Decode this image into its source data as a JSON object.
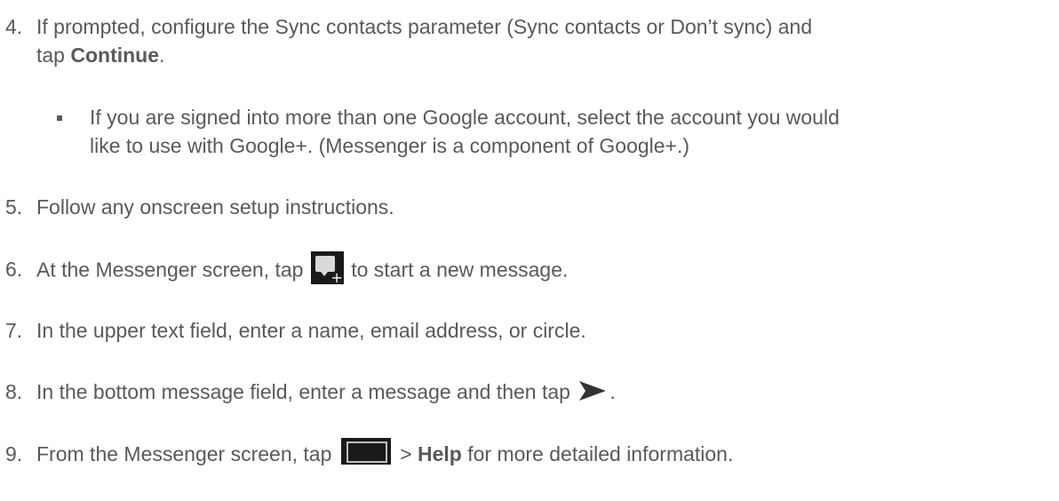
{
  "steps": [
    {
      "number": "4.",
      "line1": "If prompted, configure the Sync contacts parameter (Sync contacts or Don’t sync) and",
      "line2_prefix": "tap ",
      "line2_bold": "Continue",
      "line2_suffix": "."
    },
    {
      "number": "5.",
      "text": "Follow any onscreen setup instructions."
    },
    {
      "number": "6.",
      "prefix": "At the Messenger screen, tap ",
      "suffix": " to start a new message.",
      "icon": "new-message-icon"
    },
    {
      "number": "7.",
      "text": "In the upper text field, enter a name, email address, or circle."
    },
    {
      "number": "8.",
      "prefix": "In the bottom message field, enter a message and then tap ",
      "suffix": ".",
      "icon": "send-icon"
    },
    {
      "number": "9.",
      "prefix": "From the Messenger screen, tap ",
      "middle": " > ",
      "bold": "Help",
      "suffix": " for more detailed information.",
      "icon": "menu-icon"
    }
  ],
  "bullet": {
    "line1": "If you are signed into more than one Google account, select the account you would",
    "line2": "like to use with Google+. (Messenger is a component of Google+.)"
  },
  "colors": {
    "text": "#595959",
    "icon_background": "#1a1a1a",
    "send_arrow": "#333333"
  }
}
